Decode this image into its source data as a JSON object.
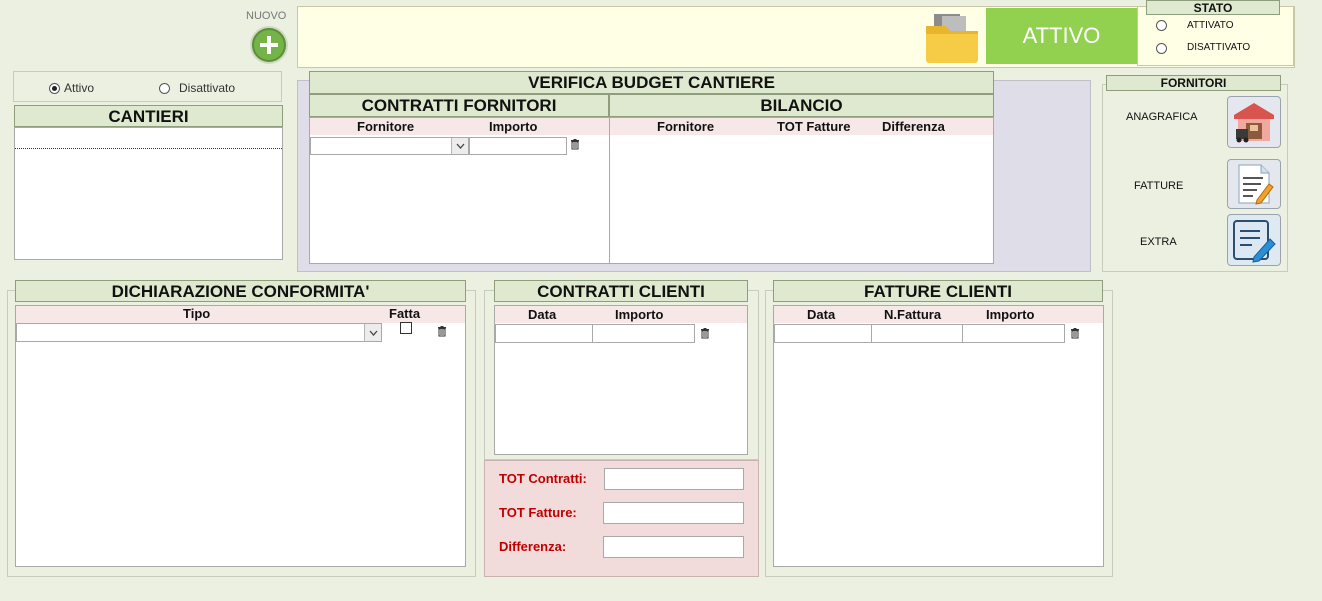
{
  "top": {
    "nuovo_label": "NUOVO",
    "status_display": "ATTIVO",
    "stato": {
      "title": "STATO",
      "options": [
        "ATTIVATO",
        "DISATTIVATO"
      ]
    }
  },
  "filter": {
    "options": [
      {
        "label": "Attivo",
        "checked": true
      },
      {
        "label": "Disattivato",
        "checked": false
      }
    ]
  },
  "cantieri": {
    "title": "CANTIERI"
  },
  "budget": {
    "title": "VERIFICA BUDGET CANTIERE",
    "contratti_fornitori": {
      "title": "CONTRATTI FORNITORI",
      "columns": [
        "Fornitore",
        "Importo"
      ]
    },
    "bilancio": {
      "title": "BILANCIO",
      "columns": [
        "Fornitore",
        "TOT Fatture",
        "Differenza"
      ]
    }
  },
  "fornitori": {
    "title": "FORNITORI",
    "items": [
      "ANAGRAFICA",
      "FATTURE",
      "EXTRA"
    ]
  },
  "dichiarazione": {
    "title": "DICHIARAZIONE CONFORMITA'",
    "columns": [
      "Tipo",
      "Fatta"
    ]
  },
  "contratti_clienti": {
    "title": "CONTRATTI CLIENTI",
    "columns": [
      "Data",
      "Importo"
    ],
    "totals": [
      "TOT Contratti:",
      "TOT Fatture:",
      "Differenza:"
    ]
  },
  "fatture_clienti": {
    "title": "FATTURE CLIENTI",
    "columns": [
      "Data",
      "N.Fattura",
      "Importo"
    ]
  },
  "colors": {
    "accent_green": "#92d050",
    "add_button": "#6aab3e",
    "header_bg": "#dfe9cf",
    "top_bar": "#ffffe6",
    "total_label": "#c00000"
  }
}
